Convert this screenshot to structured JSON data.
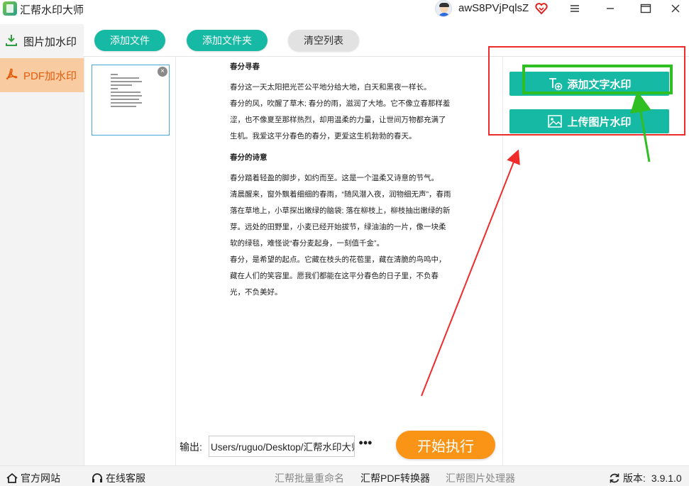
{
  "titlebar": {
    "app_title": "汇帮水印大师",
    "username": "awS8PVjPqlsZ",
    "icons": [
      "app-logo-icon",
      "avatar",
      "vip-heart-icon",
      "menu-icon",
      "minimize-icon",
      "maximize-icon",
      "close-icon"
    ]
  },
  "sidebar": {
    "items": [
      {
        "label": "图片加水印",
        "icon": "image-download-icon",
        "active": false
      },
      {
        "label": "PDF加水印",
        "icon": "pdf-icon",
        "active": true
      }
    ]
  },
  "toolbar": {
    "add_file": "添加文件",
    "add_folder": "添加文件夹",
    "clear_list": "清空列表"
  },
  "thumbnail": {
    "close_glyph": "×"
  },
  "document": {
    "title1": "春分寻春",
    "para1": "春分这一天太阳把光芒公平地分给大地，白天和黑夜一样长。",
    "para2": "春分的风，吹醒了草木; 春分的雨，滋润了大地。它不像立春那样羞涩，也不像夏至那样热烈，却用温柔的力量，让世间万物都充满了生机。我爱这平分春色的春分，更爱这生机勃勃的春天。",
    "title2": "春分的诗意",
    "para3": "春分踏着轻盈的脚步，如约而至。这是一个温柔又诗意的节气。",
    "para4": "清晨醒来，窗外飘着细细的春雨，“随风潜入夜，润物细无声”，春雨落在草地上，小草探出嫩绿的脑袋; 落在柳枝上，柳枝抽出嫩绿的新芽。远处的田野里，小麦已经开始拔节，绿油油的一片，像一块柔软的绿毯，难怪说“春分麦起身，一刻值千金”。",
    "para5": "春分，是希望的起点。它藏在枝头的花苞里，藏在清脆的鸟鸣中，藏在人们的笑容里。愿我们都能在这平分春色的日子里，不负春光，不负美好。"
  },
  "output": {
    "label": "输出:",
    "path": "Users/ruguo/Desktop/汇帮水印大师",
    "more": "•••",
    "start_button": "开始执行"
  },
  "right_panel": {
    "add_text_watermark": "添加文字水印",
    "upload_image_watermark": "上传图片水印"
  },
  "footer": {
    "official_site": "官方网站",
    "online_service": "在线客服",
    "batch_rename": "汇帮批量重命名",
    "pdf_converter": "汇帮PDF转换器",
    "image_processor": "汇帮图片处理器",
    "version_label": "版本:",
    "version_value": "3.9.1.0"
  },
  "colors": {
    "teal": "#16b9a4",
    "orange": "#fa9417",
    "active_nav_bg": "#f9cba0",
    "active_nav_text": "#e45c0d",
    "annotation_red": "#ef2b2b",
    "annotation_green": "#2fbf22"
  }
}
